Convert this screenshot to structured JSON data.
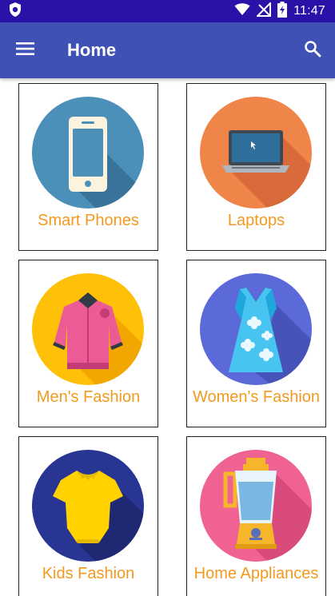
{
  "status_bar": {
    "time": "11:47",
    "icons": [
      "shield-icon",
      "wifi-icon",
      "no-signal-icon",
      "battery-charging-icon"
    ]
  },
  "app_bar": {
    "title": "Home",
    "menu_icon": "hamburger-menu-icon",
    "search_icon": "search-icon"
  },
  "categories": [
    {
      "label": "Smart Phones",
      "icon": "smartphone-icon",
      "color": "#4a90b8"
    },
    {
      "label": "Laptops",
      "icon": "laptop-icon",
      "color": "#f0854a"
    },
    {
      "label": "Men's Fashion",
      "icon": "jacket-icon",
      "color": "#ffc107"
    },
    {
      "label": "Women's Fashion",
      "icon": "dress-icon",
      "color": "#5c6ad9"
    },
    {
      "label": "Kids Fashion",
      "icon": "baby-onesie-icon",
      "color": "#283593"
    },
    {
      "label": "Home Appliances",
      "icon": "blender-icon",
      "color": "#f06292"
    }
  ],
  "colors": {
    "status_bar": "#2a12a8",
    "app_bar": "#3f51b5",
    "label_text": "#f29a1f"
  }
}
